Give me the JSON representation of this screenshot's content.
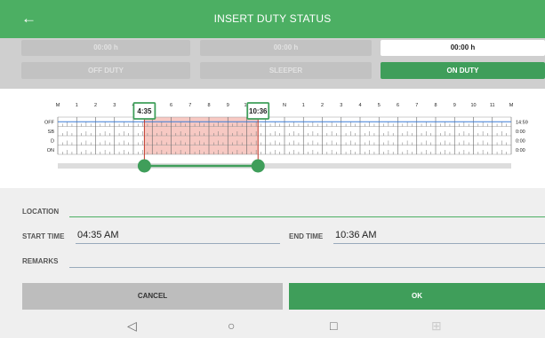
{
  "appbar": {
    "title": "INSERT DUTY STATUS",
    "back_icon": "arrow-left-icon"
  },
  "statuses": {
    "durations": [
      "00:00 h",
      "00:00 h",
      "00:00 h"
    ],
    "buttons": [
      "OFF DUTY",
      "SLEEPER",
      "ON DUTY"
    ],
    "active": "ON DUTY"
  },
  "chart": {
    "hour_labels": [
      "M",
      "1",
      "2",
      "3",
      "4",
      "5",
      "6",
      "7",
      "8",
      "9",
      "10",
      "11",
      "N",
      "1",
      "2",
      "3",
      "4",
      "5",
      "6",
      "7",
      "8",
      "9",
      "10",
      "11",
      "M"
    ],
    "row_labels": [
      "OFF",
      "SB",
      "D",
      "ON"
    ],
    "row_totals": [
      "14:59",
      "0:00",
      "0:00",
      "0:00"
    ],
    "selection": {
      "start_label": "4:35",
      "end_label": "10:36",
      "start_hours": 4.583,
      "end_hours": 10.6
    },
    "colors": {
      "selection": "#f7c9c3",
      "accent": "#3f9e5a",
      "marker": "#c0392b"
    }
  },
  "form": {
    "location_label": "LOCATION",
    "location_value": "",
    "start_label": "START TIME",
    "start_value": "04:35 AM",
    "end_label": "END TIME",
    "end_value": "10:36 AM",
    "remarks_label": "REMARKS",
    "remarks_value": ""
  },
  "actions": {
    "cancel": "CANCEL",
    "ok": "OK"
  },
  "navbar": {
    "icons": [
      "back-triangle-icon",
      "home-circle-icon",
      "recents-square-icon",
      "grid-icon"
    ]
  }
}
